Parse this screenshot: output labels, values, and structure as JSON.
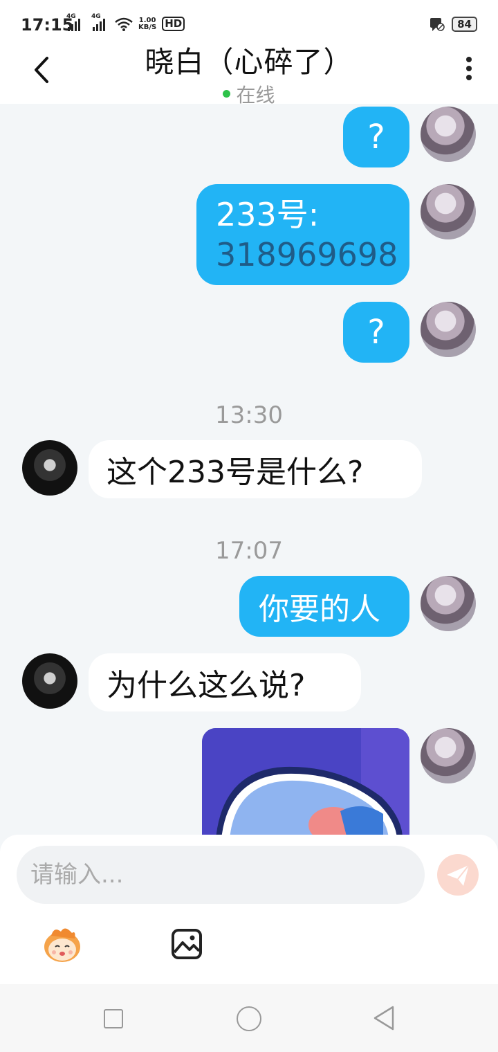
{
  "status_bar": {
    "time": "17:15",
    "network_1": "4G",
    "network_2": "4G",
    "speed_value": "1.00",
    "speed_unit": "KB/S",
    "hd_label": "HD",
    "battery": "84"
  },
  "header": {
    "title": "晓白（心碎了）",
    "status": "在线"
  },
  "messages": [
    {
      "side": "out",
      "text": "?"
    },
    {
      "side": "out",
      "line1": "233号:",
      "line2": "318969698"
    },
    {
      "side": "out",
      "text": "?"
    },
    {
      "timestamp": "13:30"
    },
    {
      "side": "in",
      "text": "这个233号是什么?"
    },
    {
      "timestamp": "17:07"
    },
    {
      "side": "out",
      "text": "你要的人"
    },
    {
      "side": "in",
      "text": "为什么这么说?"
    },
    {
      "side": "out",
      "type": "image"
    }
  ],
  "input": {
    "placeholder": "请输入..."
  },
  "colors": {
    "outgoing_bubble": "#22b4f5",
    "incoming_bubble": "#ffffff",
    "background": "#f3f6f8",
    "online_dot": "#2ec24a",
    "send_button": "#fbd9cf"
  },
  "icons": [
    "back-arrow-icon",
    "more-vertical-icon",
    "send-icon",
    "emoji-icon",
    "image-icon",
    "wifi-icon",
    "signal-icon",
    "notification-icon"
  ]
}
